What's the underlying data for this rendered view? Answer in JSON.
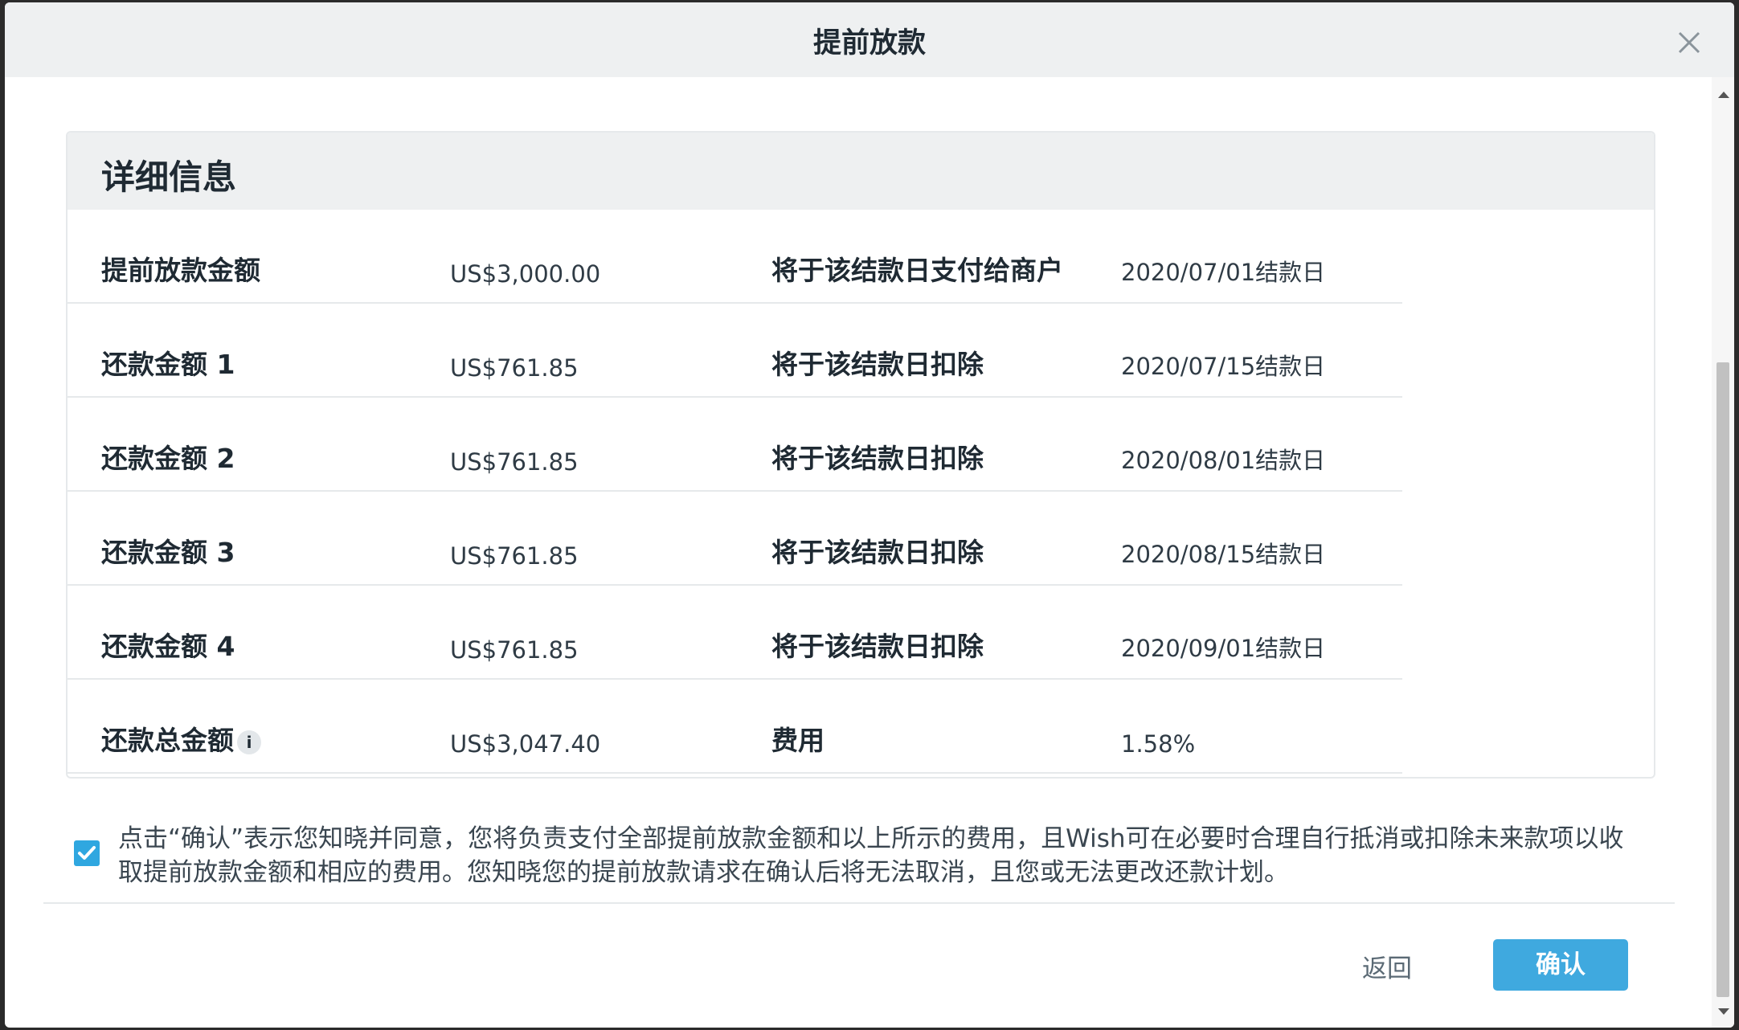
{
  "dialog": {
    "title": "提前放款",
    "close_icon": "close-icon"
  },
  "details": {
    "title": "详细信息",
    "rows": [
      {
        "label": "提前放款金额",
        "amount": "US$3,000.00",
        "label2": "将于该结款日支付给商户",
        "date": "2020/07/01结款日"
      },
      {
        "label": "还款金额 1",
        "amount": "US$761.85",
        "label2": "将于该结款日扣除",
        "date": "2020/07/15结款日"
      },
      {
        "label": "还款金额 2",
        "amount": "US$761.85",
        "label2": "将于该结款日扣除",
        "date": "2020/08/01结款日"
      },
      {
        "label": "还款金额 3",
        "amount": "US$761.85",
        "label2": "将于该结款日扣除",
        "date": "2020/08/15结款日"
      },
      {
        "label": "还款金额 4",
        "amount": "US$761.85",
        "label2": "将于该结款日扣除",
        "date": "2020/09/01结款日"
      },
      {
        "label": "还款总金额",
        "info_icon": "i",
        "amount": "US$3,047.40",
        "label2": "费用",
        "date": "1.58%"
      }
    ]
  },
  "agreement": {
    "checked": true,
    "text": "点击“确认”表示您知晓并同意，您将负责支付全部提前放款金额和以上所示的费用，且Wish可在必要时合理自行抵消或扣除未来款项以收取提前放款金额和相应的费用。您知晓您的提前放款请求在确认后将无法取消，且您或无法更改还款计划。"
  },
  "footer": {
    "back_label": "返回",
    "confirm_label": "确认"
  },
  "colors": {
    "accent": "#3fa9df",
    "header_bg": "#eef0f1"
  }
}
